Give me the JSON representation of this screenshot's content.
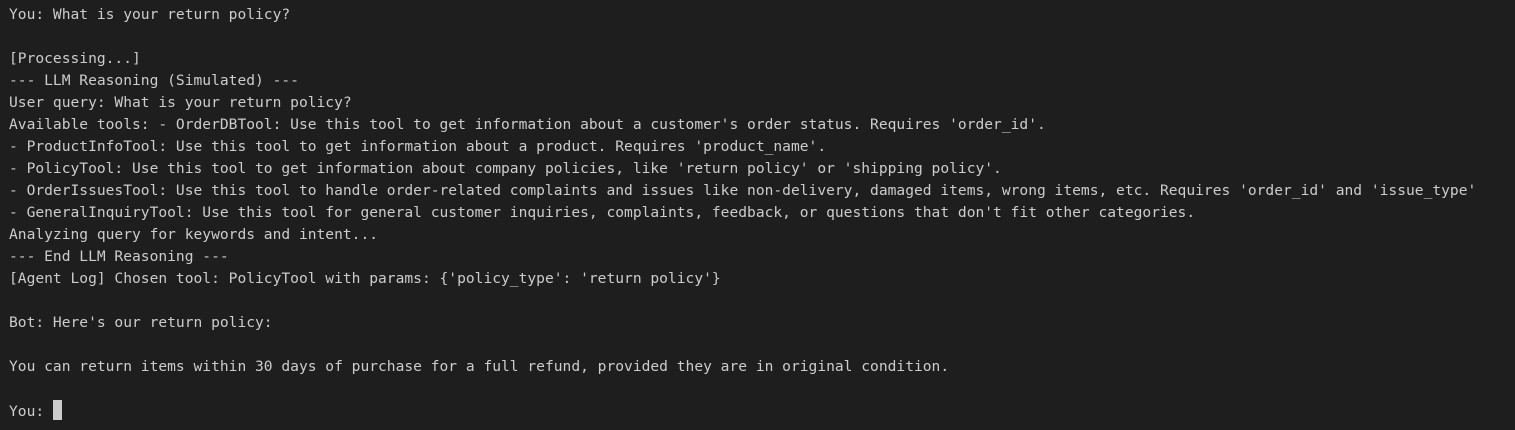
{
  "terminal": {
    "background": "#1e1e1e",
    "foreground": "#cccccc",
    "lines": [
      "You: What is your return policy?",
      "",
      "[Processing...]",
      "--- LLM Reasoning (Simulated) ---",
      "User query: What is your return policy?",
      "Available tools: - OrderDBTool: Use this tool to get information about a customer's order status. Requires 'order_id'.",
      "- ProductInfoTool: Use this tool to get information about a product. Requires 'product_name'.",
      "- PolicyTool: Use this tool to get information about company policies, like 'return policy' or 'shipping policy'.",
      "- OrderIssuesTool: Use this tool to handle order-related complaints and issues like non-delivery, damaged items, wrong items, etc. Requires 'order_id' and 'issue_type'",
      "- GeneralInquiryTool: Use this tool for general customer inquiries, complaints, feedback, or questions that don't fit other categories.",
      "Analyzing query for keywords and intent...",
      "--- End LLM Reasoning ---",
      "[Agent Log] Chosen tool: PolicyTool with params: {'policy_type': 'return policy'}",
      "",
      "Bot: Here's our return policy:",
      "",
      "You can return items within 30 days of purchase for a full refund, provided they are in original condition.",
      ""
    ],
    "prompt": "You: "
  }
}
